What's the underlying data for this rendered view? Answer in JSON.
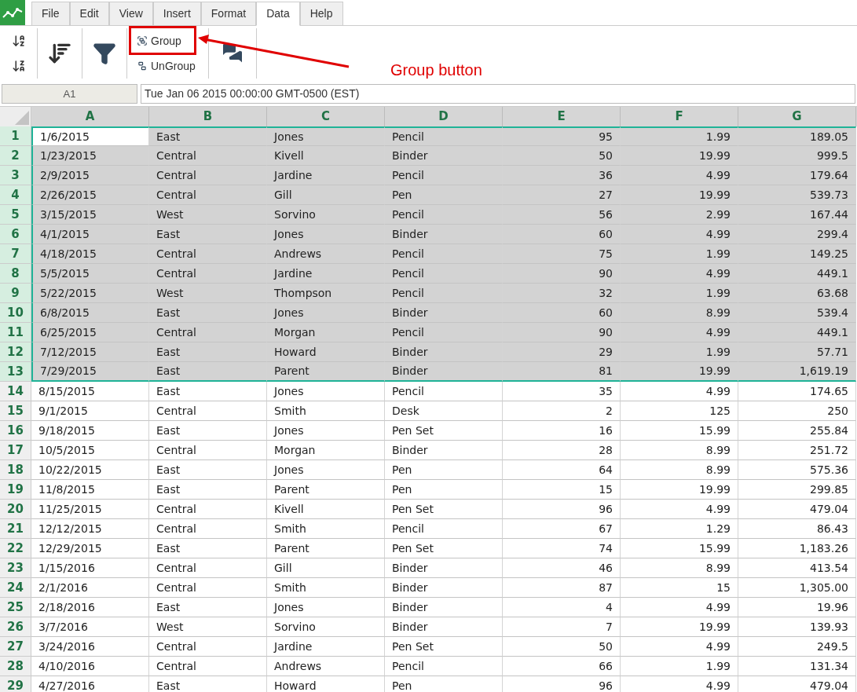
{
  "menu_tabs": [
    {
      "label": "File",
      "selected": false
    },
    {
      "label": "Edit",
      "selected": false
    },
    {
      "label": "View",
      "selected": false
    },
    {
      "label": "Insert",
      "selected": false
    },
    {
      "label": "Format",
      "selected": false
    },
    {
      "label": "Data",
      "selected": true
    },
    {
      "label": "Help",
      "selected": false
    }
  ],
  "ribbon": {
    "group_button": "Group",
    "ungroup_button": "UnGroup"
  },
  "annotation": {
    "label": "Group button"
  },
  "formula_bar": {
    "cell_name": "A1",
    "value": "Tue Jan 06 2015 00:00:00 GMT-0500 (EST)"
  },
  "columns": [
    {
      "label": "A",
      "kind": "text"
    },
    {
      "label": "B",
      "kind": "text"
    },
    {
      "label": "C",
      "kind": "text"
    },
    {
      "label": "D",
      "kind": "text"
    },
    {
      "label": "E",
      "kind": "number"
    },
    {
      "label": "F",
      "kind": "number"
    },
    {
      "label": "G",
      "kind": "number"
    }
  ],
  "rows": [
    {
      "number": "1",
      "selected": true,
      "active": true,
      "cells": [
        "1/6/2015",
        "East",
        "Jones",
        "Pencil",
        "95",
        "1.99",
        "189.05"
      ]
    },
    {
      "number": "2",
      "selected": true,
      "active": false,
      "cells": [
        "1/23/2015",
        "Central",
        "Kivell",
        "Binder",
        "50",
        "19.99",
        "999.5"
      ]
    },
    {
      "number": "3",
      "selected": true,
      "active": false,
      "cells": [
        "2/9/2015",
        "Central",
        "Jardine",
        "Pencil",
        "36",
        "4.99",
        "179.64"
      ]
    },
    {
      "number": "4",
      "selected": true,
      "active": false,
      "cells": [
        "2/26/2015",
        "Central",
        "Gill",
        "Pen",
        "27",
        "19.99",
        "539.73"
      ]
    },
    {
      "number": "5",
      "selected": true,
      "active": false,
      "cells": [
        "3/15/2015",
        "West",
        "Sorvino",
        "Pencil",
        "56",
        "2.99",
        "167.44"
      ]
    },
    {
      "number": "6",
      "selected": true,
      "active": false,
      "cells": [
        "4/1/2015",
        "East",
        "Jones",
        "Binder",
        "60",
        "4.99",
        "299.4"
      ]
    },
    {
      "number": "7",
      "selected": true,
      "active": false,
      "cells": [
        "4/18/2015",
        "Central",
        "Andrews",
        "Pencil",
        "75",
        "1.99",
        "149.25"
      ]
    },
    {
      "number": "8",
      "selected": true,
      "active": false,
      "cells": [
        "5/5/2015",
        "Central",
        "Jardine",
        "Pencil",
        "90",
        "4.99",
        "449.1"
      ]
    },
    {
      "number": "9",
      "selected": true,
      "active": false,
      "cells": [
        "5/22/2015",
        "West",
        "Thompson",
        "Pencil",
        "32",
        "1.99",
        "63.68"
      ]
    },
    {
      "number": "10",
      "selected": true,
      "active": false,
      "cells": [
        "6/8/2015",
        "East",
        "Jones",
        "Binder",
        "60",
        "8.99",
        "539.4"
      ]
    },
    {
      "number": "11",
      "selected": true,
      "active": false,
      "cells": [
        "6/25/2015",
        "Central",
        "Morgan",
        "Pencil",
        "90",
        "4.99",
        "449.1"
      ]
    },
    {
      "number": "12",
      "selected": true,
      "active": false,
      "cells": [
        "7/12/2015",
        "East",
        "Howard",
        "Binder",
        "29",
        "1.99",
        "57.71"
      ]
    },
    {
      "number": "13",
      "selected": true,
      "active": false,
      "cells": [
        "7/29/2015",
        "East",
        "Parent",
        "Binder",
        "81",
        "19.99",
        "1,619.19"
      ]
    },
    {
      "number": "14",
      "selected": false,
      "cells": [
        "8/15/2015",
        "East",
        "Jones",
        "Pencil",
        "35",
        "4.99",
        "174.65"
      ]
    },
    {
      "number": "15",
      "selected": false,
      "cells": [
        "9/1/2015",
        "Central",
        "Smith",
        "Desk",
        "2",
        "125",
        "250"
      ]
    },
    {
      "number": "16",
      "selected": false,
      "cells": [
        "9/18/2015",
        "East",
        "Jones",
        "Pen Set",
        "16",
        "15.99",
        "255.84"
      ]
    },
    {
      "number": "17",
      "selected": false,
      "cells": [
        "10/5/2015",
        "Central",
        "Morgan",
        "Binder",
        "28",
        "8.99",
        "251.72"
      ]
    },
    {
      "number": "18",
      "selected": false,
      "cells": [
        "10/22/2015",
        "East",
        "Jones",
        "Pen",
        "64",
        "8.99",
        "575.36"
      ]
    },
    {
      "number": "19",
      "selected": false,
      "cells": [
        "11/8/2015",
        "East",
        "Parent",
        "Pen",
        "15",
        "19.99",
        "299.85"
      ]
    },
    {
      "number": "20",
      "selected": false,
      "cells": [
        "11/25/2015",
        "Central",
        "Kivell",
        "Pen Set",
        "96",
        "4.99",
        "479.04"
      ]
    },
    {
      "number": "21",
      "selected": false,
      "cells": [
        "12/12/2015",
        "Central",
        "Smith",
        "Pencil",
        "67",
        "1.29",
        "86.43"
      ]
    },
    {
      "number": "22",
      "selected": false,
      "cells": [
        "12/29/2015",
        "East",
        "Parent",
        "Pen Set",
        "74",
        "15.99",
        "1,183.26"
      ]
    },
    {
      "number": "23",
      "selected": false,
      "cells": [
        "1/15/2016",
        "Central",
        "Gill",
        "Binder",
        "46",
        "8.99",
        "413.54"
      ]
    },
    {
      "number": "24",
      "selected": false,
      "cells": [
        "2/1/2016",
        "Central",
        "Smith",
        "Binder",
        "87",
        "15",
        "1,305.00"
      ]
    },
    {
      "number": "25",
      "selected": false,
      "cells": [
        "2/18/2016",
        "East",
        "Jones",
        "Binder",
        "4",
        "4.99",
        "19.96"
      ]
    },
    {
      "number": "26",
      "selected": false,
      "cells": [
        "3/7/2016",
        "West",
        "Sorvino",
        "Binder",
        "7",
        "19.99",
        "139.93"
      ]
    },
    {
      "number": "27",
      "selected": false,
      "cells": [
        "3/24/2016",
        "Central",
        "Jardine",
        "Pen Set",
        "50",
        "4.99",
        "249.5"
      ]
    },
    {
      "number": "28",
      "selected": false,
      "cells": [
        "4/10/2016",
        "Central",
        "Andrews",
        "Pencil",
        "66",
        "1.99",
        "131.34"
      ]
    },
    {
      "number": "29",
      "selected": false,
      "cells": [
        "4/27/2016",
        "East",
        "Howard",
        "Pen",
        "96",
        "4.99",
        "479.04"
      ]
    }
  ]
}
